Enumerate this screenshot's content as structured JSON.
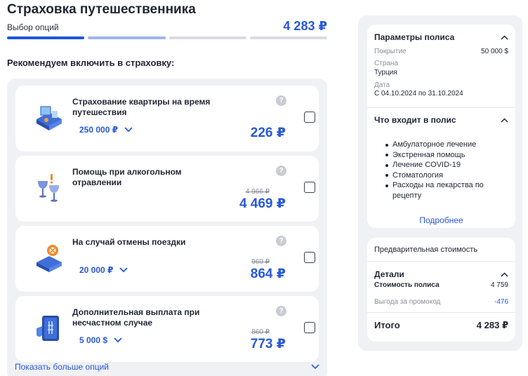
{
  "header": {
    "title": "Страховка путешественника",
    "step_label": "Выбор опций",
    "total": "4 283 ₽",
    "progress_steps": 4,
    "progress_completed": 1,
    "progress_next": 1
  },
  "recommend_title": "Рекомендуем включить в страховку:",
  "options": [
    {
      "title": "Страхование квартиры на время путешествия",
      "amount": "250 000 ₽",
      "old_price": "",
      "price": "226 ₽",
      "icon": "apartment-illustration"
    },
    {
      "title": "Помощь при алкогольном отравлении",
      "amount": "",
      "old_price": "4 966 ₽",
      "price": "4 469 ₽",
      "icon": "wine-glasses-illustration"
    },
    {
      "title": "На случай отмены поездки",
      "amount": "20 000 ₽",
      "old_price": "960 ₽",
      "price": "864 ₽",
      "icon": "cancelled-ticket-illustration"
    },
    {
      "title": "Дополнительная выплата при несчастном случае",
      "amount": "5 000 $",
      "old_price": "860 ₽",
      "price": "773 ₽",
      "icon": "xray-shield-illustration"
    }
  ],
  "show_more": "Показать больше опций",
  "policy": {
    "title": "Параметры полиса",
    "coverage_label": "Покрытие",
    "coverage_value": "50 000 $",
    "country_label": "Страна",
    "country_value": "Турция",
    "date_label": "Дата",
    "date_value": "С 04.10.2024 по 31.10.2024",
    "includes_title": "Что входит в полис",
    "includes": [
      "Амбулаторное лечение",
      "Экстренная помощь",
      "Лечение COVID-19",
      "Стоматология",
      "Расходы на лекарства по рецепту"
    ],
    "more_link": "Подробнее"
  },
  "cost": {
    "title": "Предварительная стоимость",
    "details_title": "Детали",
    "policy_cost_label": "Стоимость полиса",
    "policy_cost_value": "4 759",
    "promo_label": "Выгода за промокод",
    "promo_value": "-476",
    "total_label": "Итого",
    "total_value": "4 283 ₽"
  },
  "colors": {
    "accent": "#2858d8",
    "panel_bg": "#eff1f5",
    "text": "#1f2533",
    "muted": "#8a8f99"
  }
}
